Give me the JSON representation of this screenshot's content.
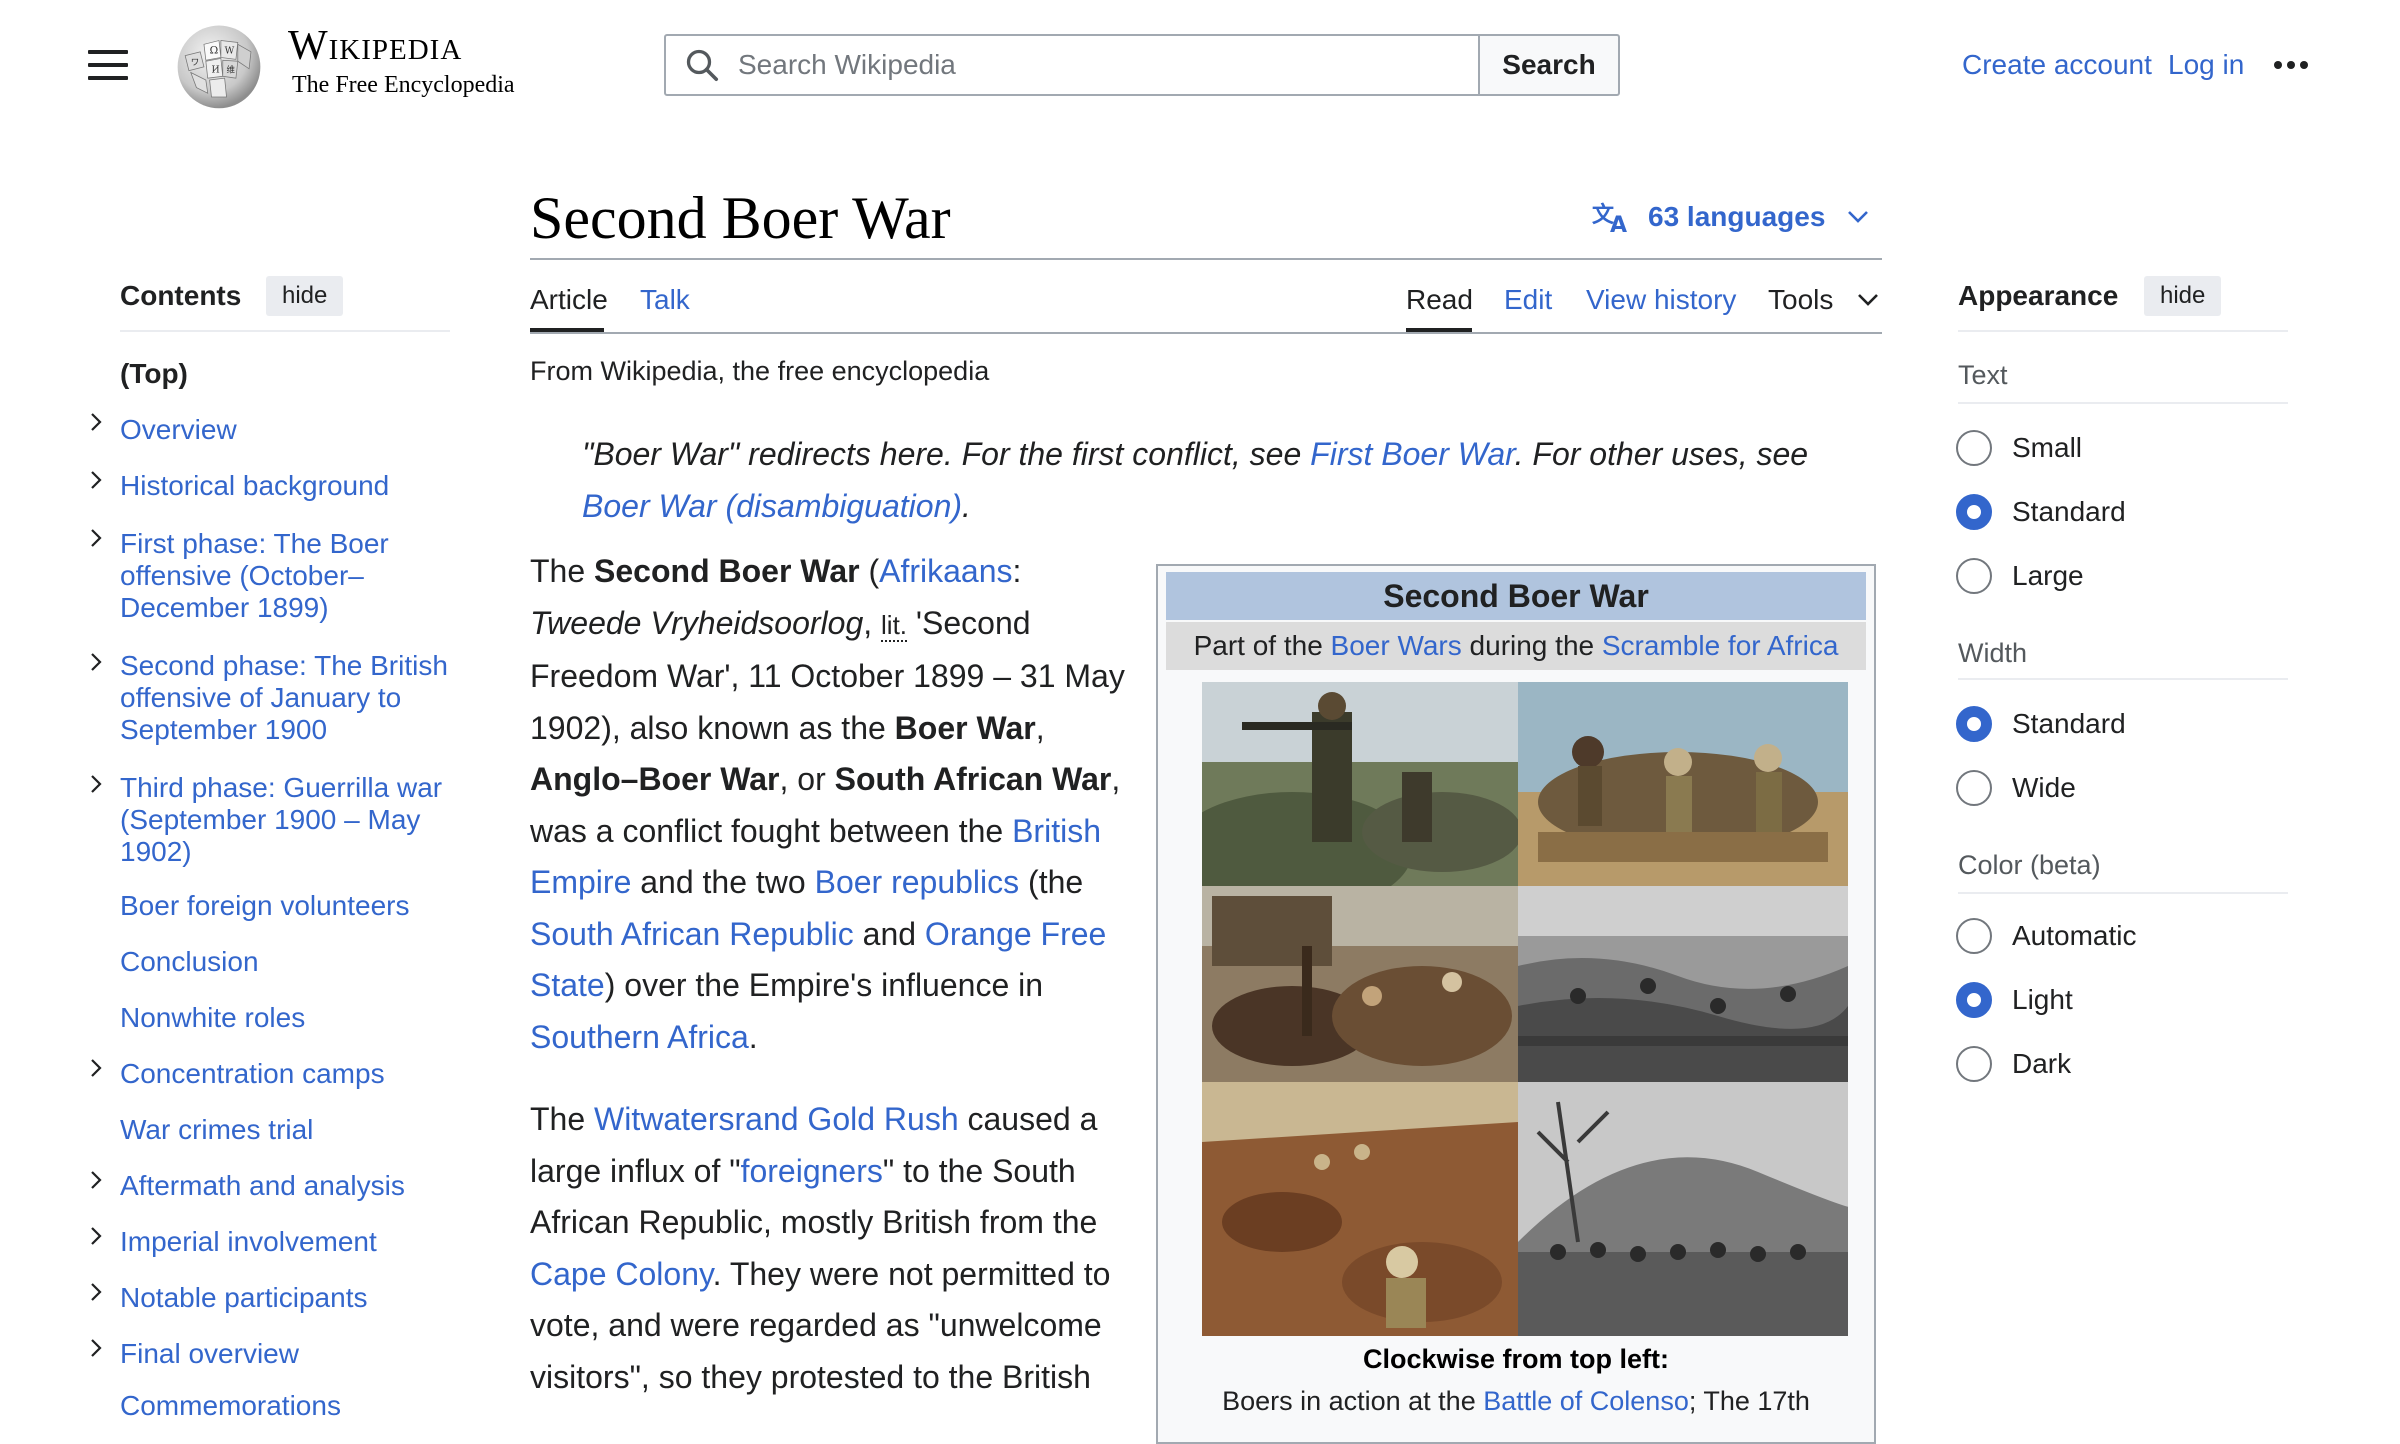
{
  "header": {
    "logo_wordmark": "Wikipedia",
    "logo_tagline": "The Free Encyclopedia",
    "search_placeholder": "Search Wikipedia",
    "search_button": "Search",
    "create_account": "Create account",
    "log_in": "Log in"
  },
  "article": {
    "title": "Second Boer War",
    "languages": "63 languages",
    "tabs": {
      "article": "Article",
      "talk": "Talk",
      "read": "Read",
      "edit": "Edit",
      "view_history": "View history",
      "tools": "Tools"
    },
    "from": "From Wikipedia, the free encyclopedia",
    "hatnote": {
      "t1": "\"Boer War\" redirects here. For the first conflict, see ",
      "l1": "First Boer War",
      "t2": ". For other uses, see ",
      "l2": "Boer War (disambiguation)",
      "t3": "."
    },
    "para1": {
      "s1": "The ",
      "b1": "Second Boer War",
      "s2": " (",
      "l_afrikaans": "Afrikaans",
      "s3": ": ",
      "i1": "Tweede Vryheidsoorlog",
      "s4": ", ",
      "abbr": "lit.",
      "s5": " 'Second Freedom War', 11 October 1899 – 31 May 1902), also known as the ",
      "b2": "Boer War",
      "s6": ", ",
      "b3": "Anglo–Boer War",
      "s7": ", or ",
      "b4": "South African War",
      "s8": ", was a conflict fought between the ",
      "l_british": "British Empire",
      "s9": " and the two ",
      "l_republics": "Boer republics",
      "s10": " (the ",
      "l_sar": "South African Republic",
      "s11": " and ",
      "l_ofs": "Orange Free State",
      "s12": ") over the Empire's influence in ",
      "l_sa": "Southern Africa",
      "s13": "."
    },
    "para2": {
      "s1": "The ",
      "l_gold": "Witwatersrand Gold Rush",
      "s2": " caused a large influx of \"",
      "l_foreigners": "foreigners",
      "s3": "\" to the South African Republic, mostly British from the ",
      "l_cape": "Cape Colony",
      "s4": ". They were not permitted to vote, and were regarded as \"unwelcome visitors\", so they protested to the British"
    },
    "infobox": {
      "title": "Second Boer War",
      "sub1": "Part of the ",
      "sub_l1": "Boer Wars",
      "sub2": " during the ",
      "sub_l2": "Scramble for Africa",
      "caption_bold": "Clockwise from top left:",
      "caption_t1": "Boers in action at the ",
      "caption_l1": "Battle of Colenso",
      "caption_t2": "; The 17th"
    }
  },
  "toc": {
    "heading": "Contents",
    "hide": "hide",
    "top": "(Top)",
    "items": [
      "Overview",
      "Historical background",
      "First phase: The Boer offensive (October–December 1899)",
      "Second phase: The British offensive of January to September 1900",
      "Third phase: Guerrilla war (September 1900 – May 1902)",
      "Boer foreign volunteers",
      "Conclusion",
      "Nonwhite roles",
      "Concentration camps",
      "War crimes trial",
      "Aftermath and analysis",
      "Imperial involvement",
      "Notable participants",
      "Final overview",
      "Commemorations"
    ]
  },
  "appearance": {
    "heading": "Appearance",
    "hide": "hide",
    "text_label": "Text",
    "text_options": [
      "Small",
      "Standard",
      "Large"
    ],
    "text_selected": "Standard",
    "width_label": "Width",
    "width_options": [
      "Standard",
      "Wide"
    ],
    "width_selected": "Standard",
    "color_label": "Color (beta)",
    "color_options": [
      "Automatic",
      "Light",
      "Dark"
    ],
    "color_selected": "Light"
  },
  "colors": {
    "link": "#3366cc",
    "text": "#202122",
    "infobox_title_bg": "#b0c4de",
    "infobox_sub_bg": "#dcdcdc"
  }
}
